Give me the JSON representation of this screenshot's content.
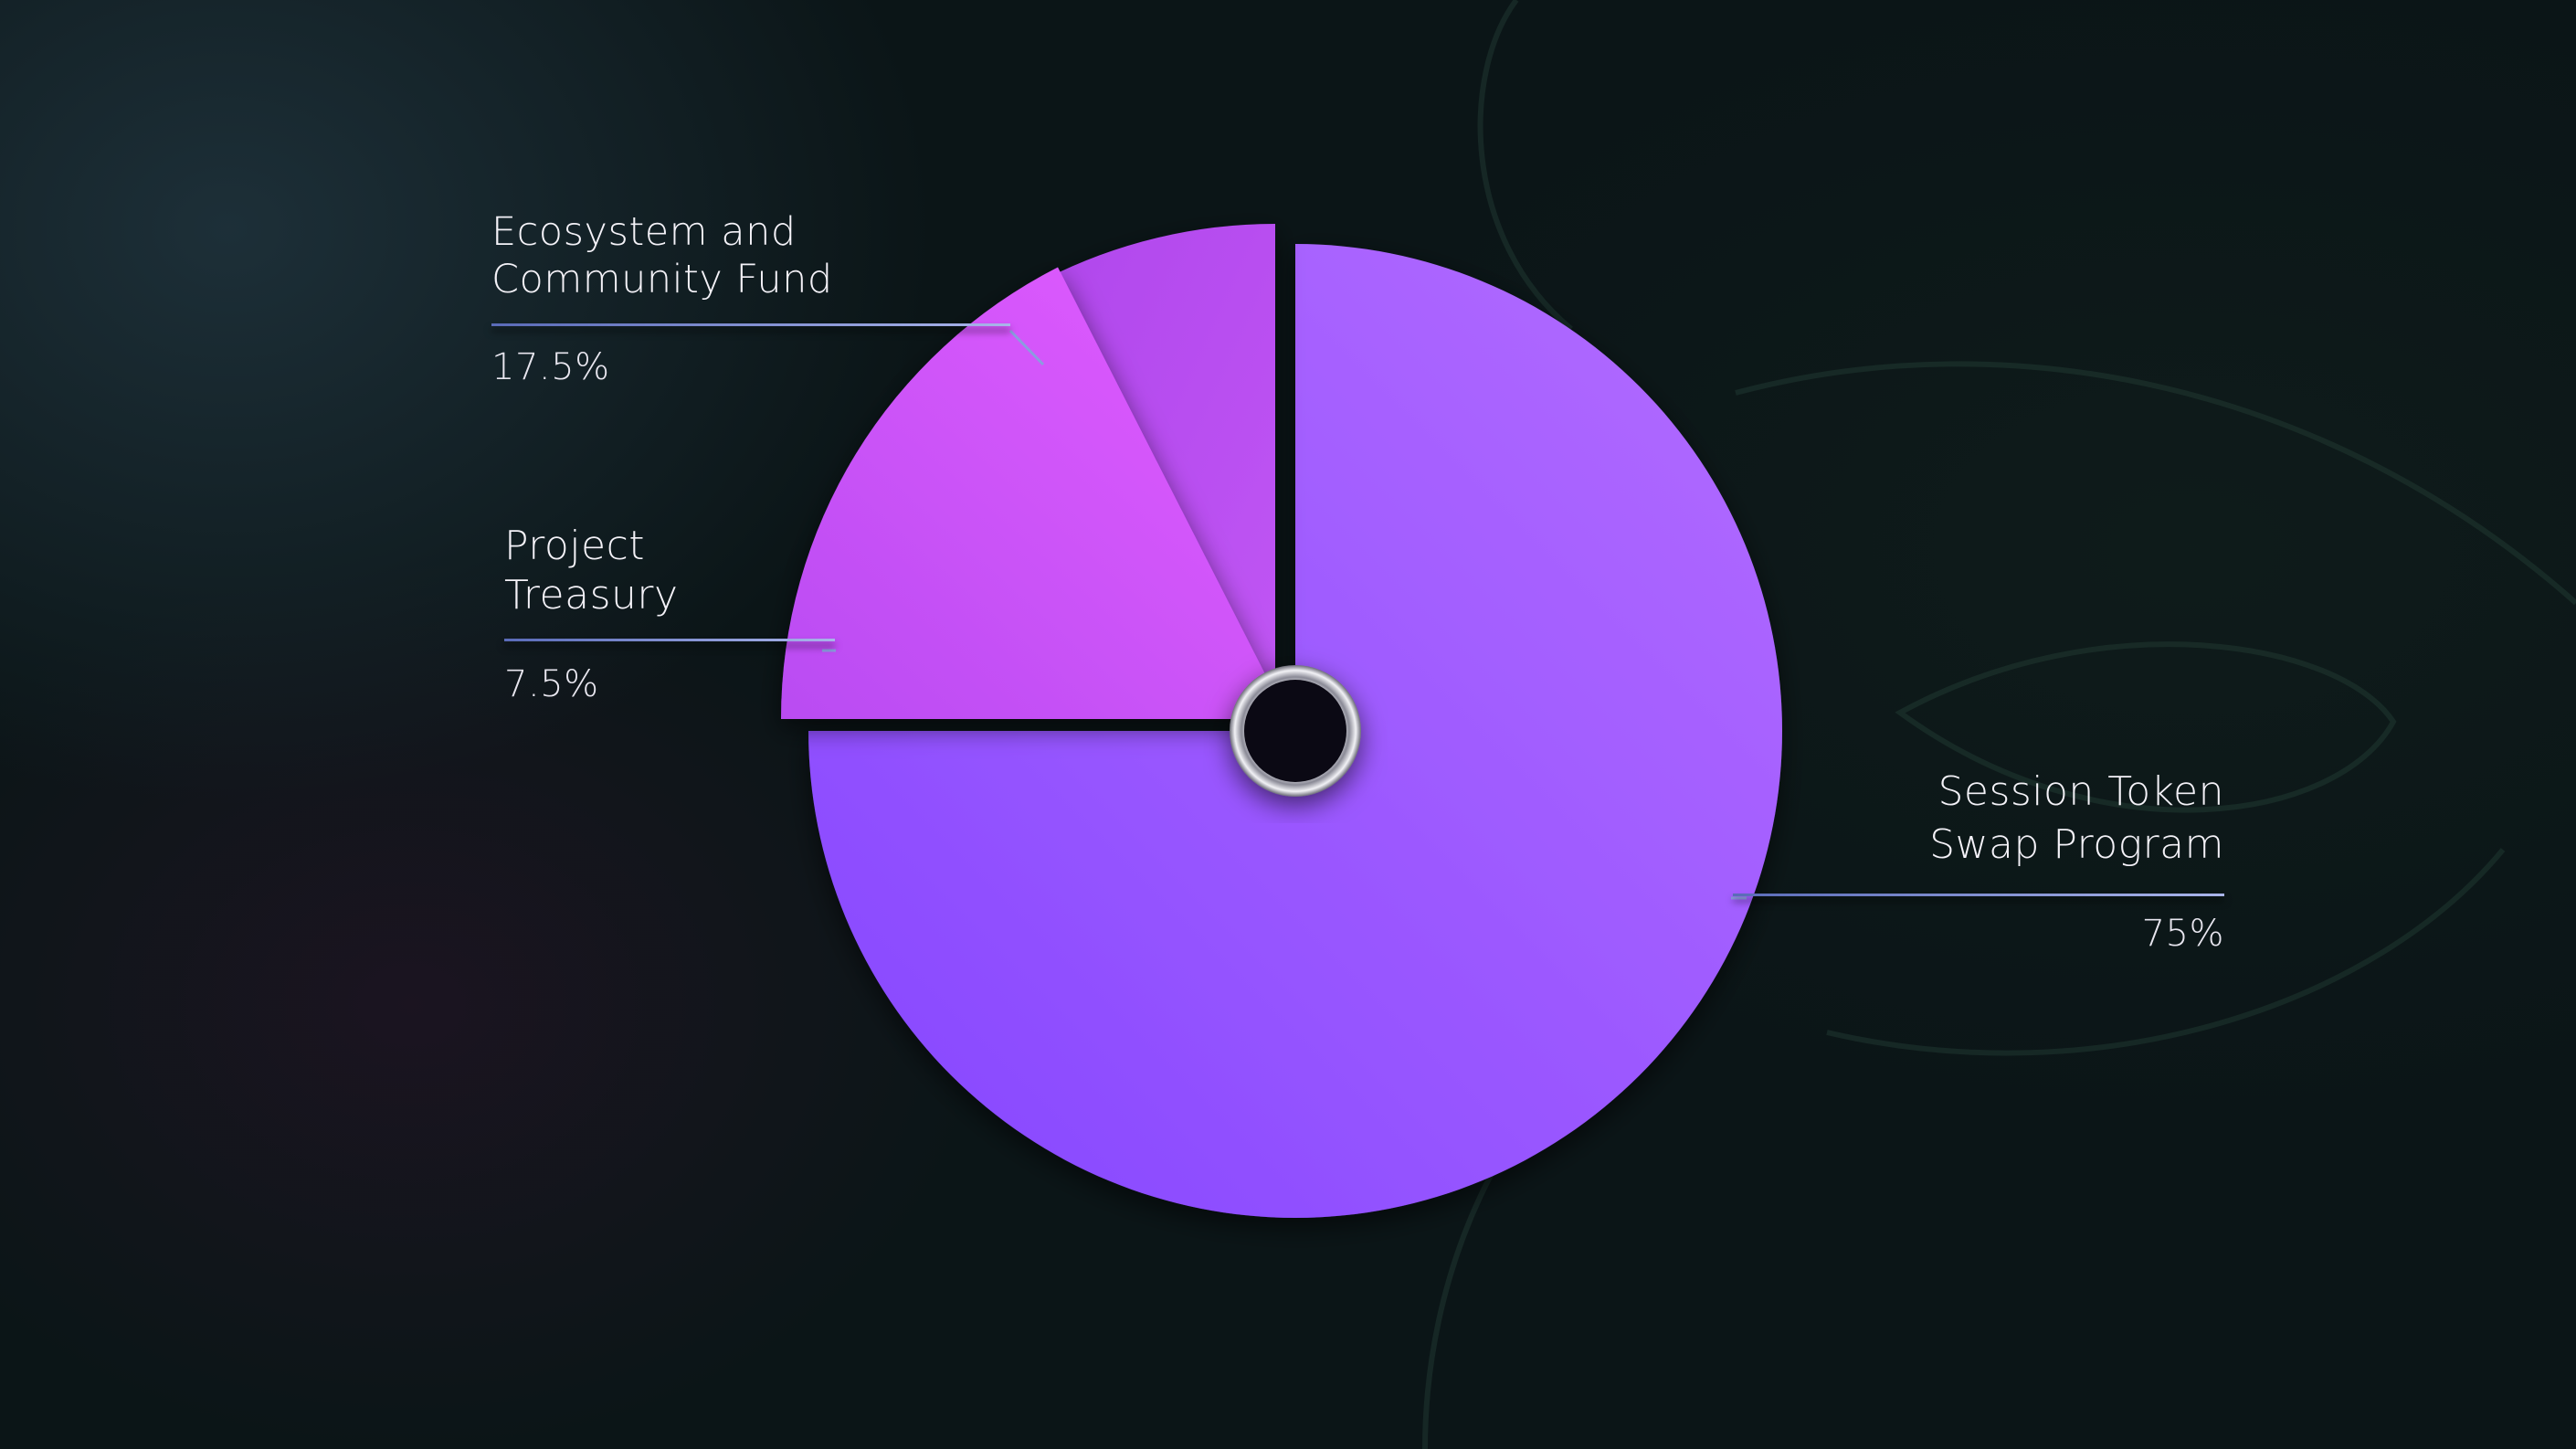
{
  "colors": {
    "background": "#0b1517",
    "session_slice_light": "#b46cff",
    "session_slice_dark": "#8446ff",
    "ecosystem_slice_light": "#dd5cff",
    "ecosystem_slice_dark": "#b94cf2",
    "treasury_slice": "#b44ef0",
    "label_text": "#ffffff",
    "leader_line": "#8c9be0"
  },
  "chart_data": {
    "type": "pie",
    "categories": [
      "Session Token Swap Program",
      "Ecosystem and Community Fund",
      "Project Treasury"
    ],
    "values": [
      75,
      17.5,
      7.5
    ],
    "labels": [
      {
        "name_lines": [
          "Session Token",
          "Swap Program"
        ],
        "value_text": "75%"
      },
      {
        "name_lines": [
          "Ecosystem and",
          "Community Fund"
        ],
        "value_text": "17.5%"
      },
      {
        "name_lines": [
          "Project",
          "Treasury"
        ],
        "value_text": "7.5%"
      }
    ],
    "start_angle_deg": 0,
    "direction": "clockwise",
    "exploded": [
      "Ecosystem and Community Fund",
      "Project Treasury"
    ],
    "center_ring": true,
    "legend": "none"
  }
}
